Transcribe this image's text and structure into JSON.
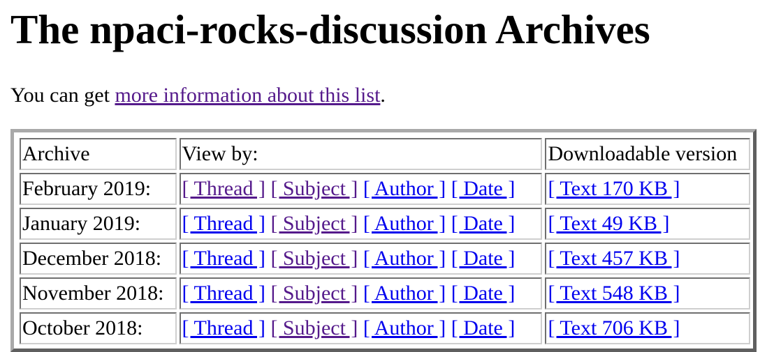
{
  "page": {
    "title": "The npaci-rocks-discussion Archives",
    "intro_prefix": "You can get ",
    "intro_link": "more information about this list",
    "intro_suffix": "."
  },
  "table": {
    "headers": {
      "archive": "Archive",
      "view_by": "View by:",
      "download": "Downloadable version"
    },
    "rows": [
      {
        "month": "February 2019:",
        "thread": "[ Thread ]",
        "subject": "[ Subject ]",
        "author": "[ Author ]",
        "date": "[ Date ]",
        "text": "[ Text 170 KB ]"
      },
      {
        "month": "January 2019:",
        "thread": "[ Thread ]",
        "subject": "[ Subject ]",
        "author": "[ Author ]",
        "date": "[ Date ]",
        "text": "[ Text 49 KB ]"
      },
      {
        "month": "December 2018:",
        "thread": "[ Thread ]",
        "subject": "[ Subject ]",
        "author": "[ Author ]",
        "date": "[ Date ]",
        "text": "[ Text 457 KB ]"
      },
      {
        "month": "November 2018:",
        "thread": "[ Thread ]",
        "subject": "[ Subject ]",
        "author": "[ Author ]",
        "date": "[ Date ]",
        "text": "[ Text 548 KB ]"
      },
      {
        "month": "October 2018:",
        "thread": "[ Thread ]",
        "subject": "[ Subject ]",
        "author": "[ Author ]",
        "date": "[ Date ]",
        "text": "[ Text 706 KB ]"
      }
    ]
  },
  "colors": {
    "link": "#0000ee",
    "visited_link": "#551a8b"
  }
}
